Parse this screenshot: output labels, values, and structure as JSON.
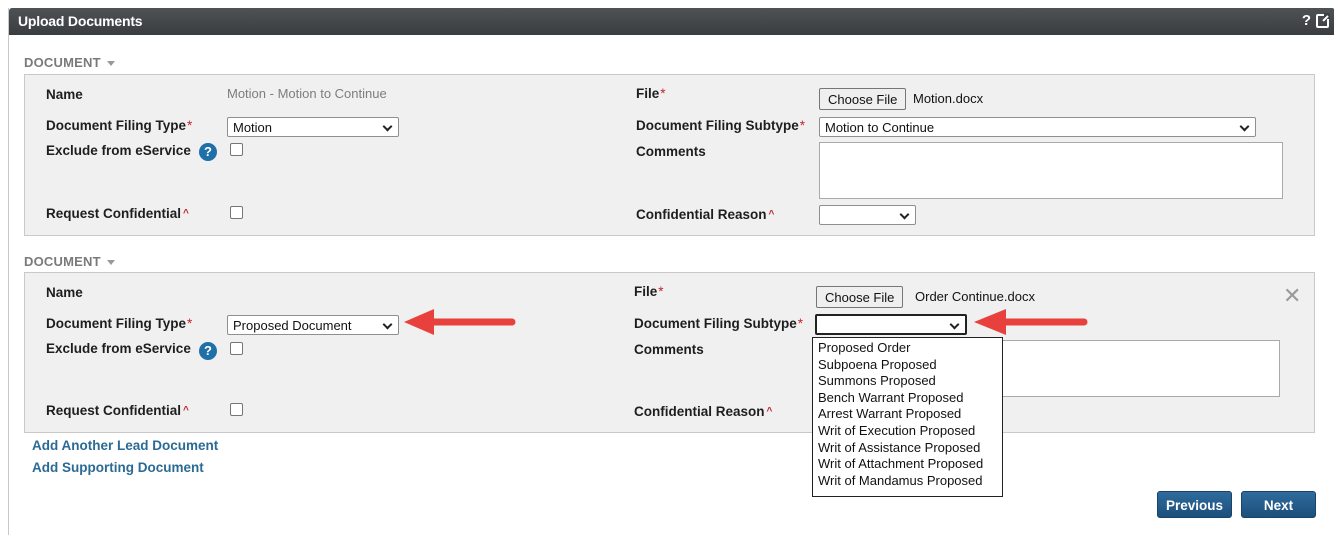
{
  "window": {
    "title": "Upload Documents",
    "help_label": "?"
  },
  "documents": [
    {
      "section_label": "DOCUMENT",
      "name_label": "Name",
      "name_value": "Motion - Motion to Continue",
      "file_label": "File",
      "file_button": "Choose File",
      "file_name": "Motion.docx",
      "filing_type_label": "Document Filing Type",
      "filing_type_value": "Motion",
      "filing_subtype_label": "Document Filing Subtype",
      "filing_subtype_value": "Motion to Continue",
      "exclude_label": "Exclude from eService",
      "comments_label": "Comments",
      "request_conf_label": "Request Confidential",
      "conf_reason_label": "Confidential Reason",
      "conf_reason_value": ""
    },
    {
      "section_label": "DOCUMENT",
      "name_label": "Name",
      "file_label": "File",
      "file_button": "Choose File",
      "file_name": "Order Continue.docx",
      "filing_type_label": "Document Filing Type",
      "filing_type_value": "Proposed Document",
      "filing_subtype_label": "Document Filing Subtype",
      "filing_subtype_value": "",
      "exclude_label": "Exclude from eService",
      "comments_label": "Comments",
      "request_conf_label": "Request Confidential",
      "conf_reason_label": "Confidential Reason"
    }
  ],
  "required_mark": "*",
  "confidential_mark": "^",
  "help_icon_glyph": "?",
  "close_glyph": "✕",
  "subtype_options": [
    "Proposed Order",
    "Subpoena Proposed",
    "Summons Proposed",
    "Bench Warrant Proposed",
    "Arrest Warrant Proposed",
    "Writ of Execution Proposed",
    "Writ of Assistance Proposed",
    "Writ of Attachment Proposed",
    "Writ of Mandamus Proposed"
  ],
  "links": {
    "add_lead": "Add Another Lead Document",
    "add_supporting": "Add Supporting Document"
  },
  "buttons": {
    "previous": "Previous",
    "next": "Next"
  },
  "colors": {
    "arrow": "#e8403c",
    "accent": "#1f5a8a",
    "title_bar": "#45484a"
  }
}
